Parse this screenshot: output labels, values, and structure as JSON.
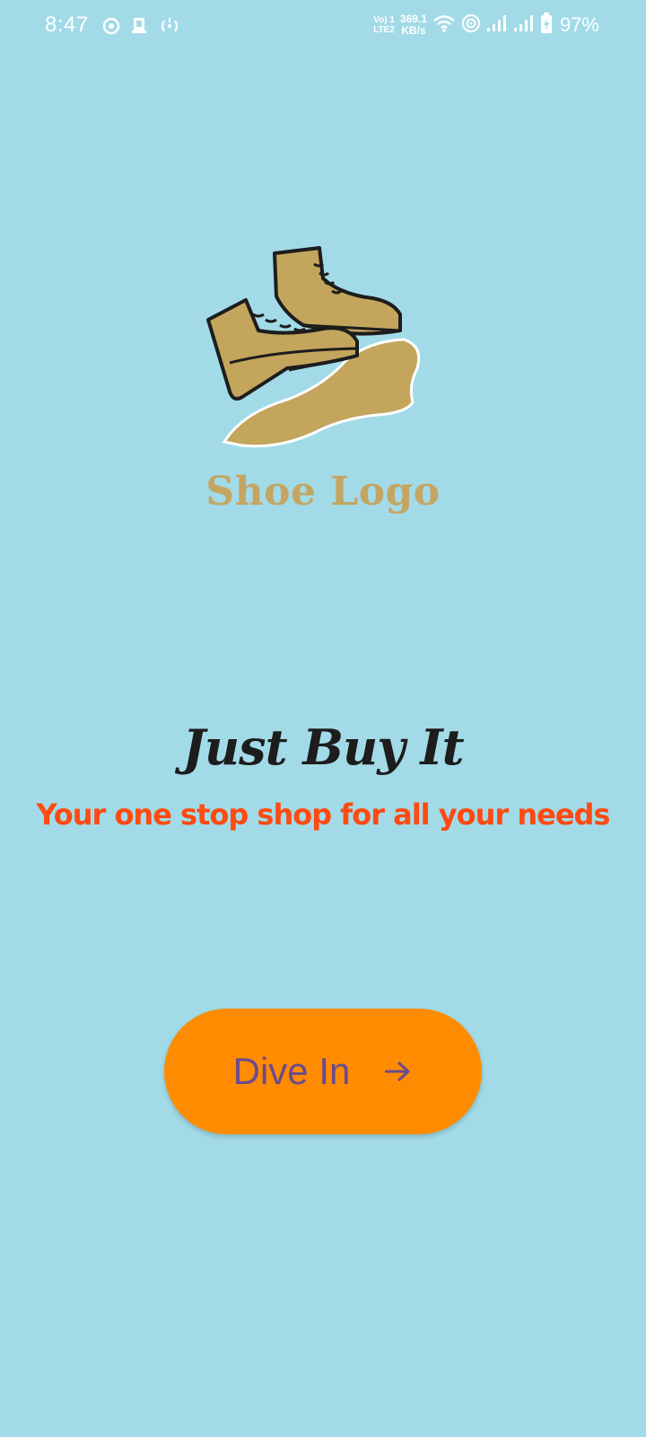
{
  "status_bar": {
    "time": "8:47",
    "net_type_top": "Vo) 1",
    "net_type_bottom": "LTE2",
    "speed_value": "369.1",
    "speed_unit": "KB/s",
    "battery": "97%"
  },
  "logo": {
    "text": "Shoe Logo",
    "color": "#c4a563"
  },
  "headline": "Just Buy It",
  "tagline": "Your one stop shop for all your needs",
  "cta": {
    "label": "Dive In",
    "icon": "arrow-right-icon",
    "background": "#ff8c00",
    "text_color": "#6b4b8d"
  },
  "colors": {
    "background": "#a2dbe7",
    "tagline": "#ff4a12",
    "headline": "#1d1d1d"
  }
}
